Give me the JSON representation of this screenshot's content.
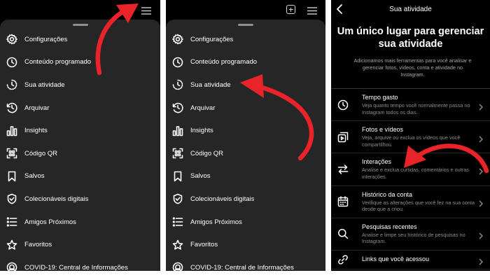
{
  "menu_items": [
    {
      "label": "Configurações",
      "icon": "gear-icon"
    },
    {
      "label": "Conteúdo programado",
      "icon": "clock-icon"
    },
    {
      "label": "Sua atividade",
      "icon": "activity-icon"
    },
    {
      "label": "Arquivar",
      "icon": "archive-icon"
    },
    {
      "label": "Insights",
      "icon": "insights-icon"
    },
    {
      "label": "Código QR",
      "icon": "qr-code-icon"
    },
    {
      "label": "Salvos",
      "icon": "bookmark-icon"
    },
    {
      "label": "Colecionáveis digitais",
      "icon": "shield-check-icon"
    },
    {
      "label": "Amigos Próximos",
      "icon": "close-friends-icon"
    },
    {
      "label": "Favoritos",
      "icon": "star-icon"
    },
    {
      "label": "COVID-19: Central de Informações",
      "icon": "info-center-icon"
    }
  ],
  "activity_screen": {
    "title": "Sua atividade",
    "headline": "Um único lugar para gerenciar sua atividade",
    "intro": "Adicionamos mais ferramentas para você analisar e gerenciar fotos, vídeos, conta e atividade no Instagram.",
    "items": [
      {
        "title": "Tempo gasto",
        "desc": "Veja quanto tempo você normalmente passa no Instagram todos os dias.",
        "icon": "clock-icon"
      },
      {
        "title": "Fotos e vídeos",
        "desc": "Veja, arquive ou exclua os vídeos que você compartilhou.",
        "icon": "photos-videos-icon"
      },
      {
        "title": "Interações",
        "desc": "Analise e exclua curtidas, comentários e outras interações.",
        "icon": "interactions-icon"
      },
      {
        "title": "Histórico da conta",
        "desc": "Verifique as alterações que você fez na sua conta desde que a criou.",
        "icon": "calendar-icon"
      },
      {
        "title": "Pesquisas recentes",
        "desc": "Analise e limpe seu histórico de pesquisas no Instagram.",
        "icon": "search-icon"
      },
      {
        "title": "Links que você acessou",
        "desc": "",
        "icon": "link-icon"
      }
    ]
  },
  "colors": {
    "background": "#000000",
    "sheet": "#262626",
    "arrow": "#e8232a",
    "muted_text": "#8e8e8e"
  }
}
